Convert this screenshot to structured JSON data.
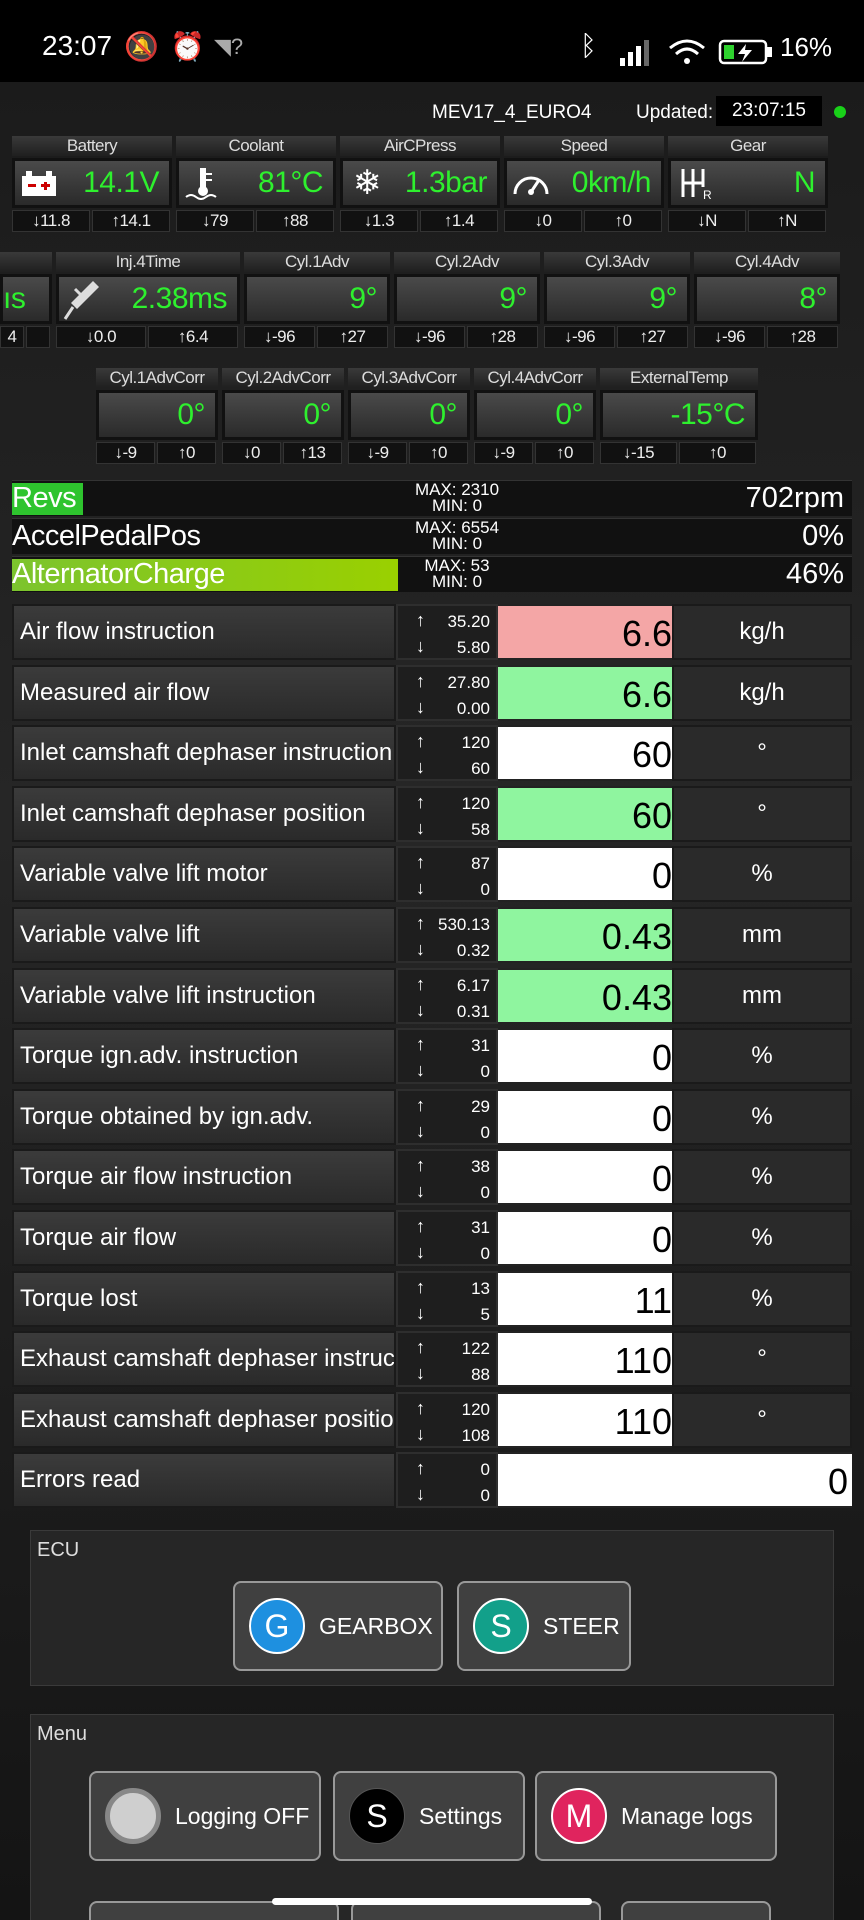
{
  "status_bar": {
    "time": "23:07",
    "battery_percent": "16%",
    "icons": [
      "mute-bell-icon",
      "alarm-icon",
      "wifi-question-icon",
      "bluetooth-icon",
      "signal-icon",
      "wifi-icon",
      "battery-charging-icon"
    ]
  },
  "header": {
    "ecu_name": "MEV17_4_EURO4",
    "updated_label": "Updated:",
    "updated_time": "23:07:15",
    "indicator_color": "#19d119"
  },
  "gauges_row1": [
    {
      "title": "Battery",
      "value": "14.1V",
      "min": "↓11.8",
      "max": "↑14.1",
      "icon": "battery-icon"
    },
    {
      "title": "Coolant",
      "value": "81°C",
      "min": "↓79",
      "max": "↑88",
      "icon": "coolant-temp-icon"
    },
    {
      "title": "AirCPress",
      "value": "1.3bar",
      "min": "↓1.3",
      "max": "↑1.4",
      "icon": "snowflake-icon"
    },
    {
      "title": "Speed",
      "value": "0km/h",
      "min": "↓0",
      "max": "↑0",
      "icon": "speedometer-icon"
    },
    {
      "title": "Gear",
      "value": "N",
      "min": "↓N",
      "max": "↑N",
      "icon": "gear-shift-icon"
    }
  ],
  "gauges_row2": [
    {
      "title": "",
      "value": "ıs",
      "min": "4",
      "max": "",
      "icon": ""
    },
    {
      "title": "Inj.4Time",
      "value": "2.38ms",
      "min": "↓0.0",
      "max": "↑6.4",
      "icon": "injector-icon"
    },
    {
      "title": "Cyl.1Adv",
      "value": "9°",
      "min": "↓-96",
      "max": "↑27",
      "icon": ""
    },
    {
      "title": "Cyl.2Adv",
      "value": "9°",
      "min": "↓-96",
      "max": "↑28",
      "icon": ""
    },
    {
      "title": "Cyl.3Adv",
      "value": "9°",
      "min": "↓-96",
      "max": "↑27",
      "icon": ""
    },
    {
      "title": "Cyl.4Adv",
      "value": "8°",
      "min": "↓-96",
      "max": "↑28",
      "icon": ""
    }
  ],
  "gauges_row3": [
    {
      "title": "Cyl.1AdvCorr",
      "value": "0°",
      "min": "↓-9",
      "max": "↑0"
    },
    {
      "title": "Cyl.2AdvCorr",
      "value": "0°",
      "min": "↓0",
      "max": "↑13"
    },
    {
      "title": "Cyl.3AdvCorr",
      "value": "0°",
      "min": "↓-9",
      "max": "↑0"
    },
    {
      "title": "Cyl.4AdvCorr",
      "value": "0°",
      "min": "↓-9",
      "max": "↑0"
    },
    {
      "title": "ExternalTemp",
      "value": "-15°C",
      "min": "↓-15",
      "max": "↑0"
    }
  ],
  "bars": [
    {
      "name": "Revs",
      "max": "MAX: 2310",
      "min": "MIN: 0",
      "value": "702rpm",
      "fill_fraction": 0.084,
      "fill_color": "#2ec42e"
    },
    {
      "name": "AccelPedalPos",
      "max": "MAX: 6554",
      "min": "MIN: 0",
      "value": "0%",
      "fill_fraction": 0,
      "fill_color": "#2ec42e"
    },
    {
      "name": "AlternatorCharge",
      "max": "MAX: 53",
      "min": "MIN: 0",
      "value": "46%",
      "fill_fraction": 0.46,
      "fill_color": "#7cc42e"
    }
  ],
  "rows": [
    {
      "name": "Air flow instruction",
      "max": "35.20",
      "min": "5.80",
      "value": "6.6",
      "unit": "kg/h",
      "bg": "#f4a6a6"
    },
    {
      "name": "Measured air flow",
      "max": "27.80",
      "min": "0.00",
      "value": "6.6",
      "unit": "kg/h",
      "bg": "#8ff59f"
    },
    {
      "name": "Inlet camshaft dephaser instruction",
      "max": "120",
      "min": "60",
      "value": "60",
      "unit": "°",
      "bg": "#ffffff"
    },
    {
      "name": "Inlet camshaft dephaser position",
      "max": "120",
      "min": "58",
      "value": "60",
      "unit": "°",
      "bg": "#8ff59f"
    },
    {
      "name": "Variable valve lift motor",
      "max": "87",
      "min": "0",
      "value": "0",
      "unit": "%",
      "bg": "#ffffff"
    },
    {
      "name": "Variable valve lift",
      "max": "530.13",
      "min": "0.32",
      "value": "0.43",
      "unit": "mm",
      "bg": "#8ff59f"
    },
    {
      "name": "Variable valve lift instruction",
      "max": "6.17",
      "min": "0.31",
      "value": "0.43",
      "unit": "mm",
      "bg": "#8ff59f"
    },
    {
      "name": "Torque ign.adv. instruction",
      "max": "31",
      "min": "0",
      "value": "0",
      "unit": "%",
      "bg": "#ffffff"
    },
    {
      "name": "Torque obtained by ign.adv.",
      "max": "29",
      "min": "0",
      "value": "0",
      "unit": "%",
      "bg": "#ffffff"
    },
    {
      "name": "Torque air flow instruction",
      "max": "38",
      "min": "0",
      "value": "0",
      "unit": "%",
      "bg": "#ffffff"
    },
    {
      "name": "Torque air flow",
      "max": "31",
      "min": "0",
      "value": "0",
      "unit": "%",
      "bg": "#ffffff"
    },
    {
      "name": "Torque lost",
      "max": "13",
      "min": "5",
      "value": "11",
      "unit": "%",
      "bg": "#ffffff"
    },
    {
      "name": "Exhaust camshaft dephaser instruction",
      "max": "122",
      "min": "88",
      "value": "110",
      "unit": "°",
      "bg": "#ffffff"
    },
    {
      "name": "Exhaust camshaft dephaser position",
      "max": "120",
      "min": "108",
      "value": "110",
      "unit": "°",
      "bg": "#ffffff"
    },
    {
      "name": "Errors read",
      "max": "0",
      "min": "0",
      "value": "0",
      "unit": "",
      "bg": "#ffffff"
    }
  ],
  "ecu_box": {
    "title": "ECU",
    "buttons": [
      {
        "letter": "G",
        "label": "GEARBOX",
        "color": "#1e90e0"
      },
      {
        "letter": "S",
        "label": "STEER",
        "color": "#12a08a"
      }
    ]
  },
  "menu_box": {
    "title": "Menu",
    "buttons": [
      {
        "letter": "",
        "label": "Logging OFF",
        "color": "#cfcfcf"
      },
      {
        "letter": "S",
        "label": "Settings",
        "color": "#000000"
      },
      {
        "letter": "M",
        "label": "Manage logs",
        "color": "#e0245e"
      }
    ]
  },
  "arrows": {
    "up": "↑",
    "down": "↓"
  }
}
